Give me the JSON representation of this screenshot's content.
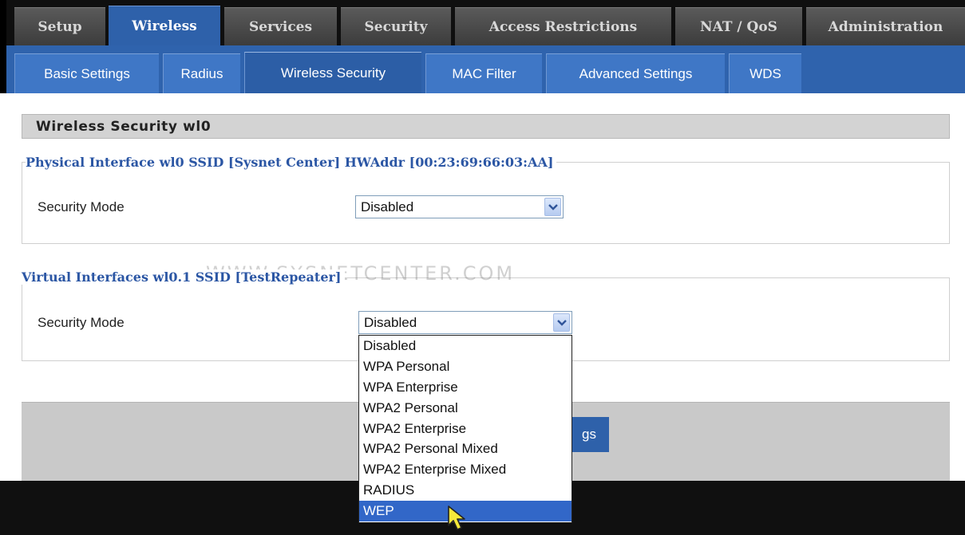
{
  "main_tabs": [
    {
      "label": "Setup"
    },
    {
      "label": "Wireless"
    },
    {
      "label": "Services"
    },
    {
      "label": "Security"
    },
    {
      "label": "Access Restrictions"
    },
    {
      "label": "NAT / QoS"
    },
    {
      "label": "Administration"
    }
  ],
  "active_main_tab": "Wireless",
  "sub_tabs": [
    {
      "label": "Basic Settings"
    },
    {
      "label": "Radius"
    },
    {
      "label": "Wireless Security"
    },
    {
      "label": "MAC Filter"
    },
    {
      "label": "Advanced Settings"
    },
    {
      "label": "WDS"
    }
  ],
  "active_sub_tab": "Wireless Security",
  "section_title": "Wireless Security wl0",
  "physical_interface": {
    "legend": "Physical Interface wl0 SSID [Sysnet Center] HWAddr [00:23:69:66:03:AA]",
    "security_mode_label": "Security Mode",
    "security_mode_value": "Disabled"
  },
  "virtual_interface": {
    "legend": "Virtual Interfaces wl0.1 SSID [TestRepeater]",
    "security_mode_label": "Security Mode",
    "security_mode_value": "Disabled"
  },
  "watermark": "WWW.SYSNETCENTER.COM",
  "dropdown_options": [
    "Disabled",
    "WPA Personal",
    "WPA Enterprise",
    "WPA2 Personal",
    "WPA2 Enterprise",
    "WPA2 Personal Mixed",
    "WPA2 Enterprise Mixed",
    "RADIUS",
    "WEP"
  ],
  "dropdown_highlighted": "WEP",
  "save_button_visible_text": "gs",
  "colors": {
    "accent_blue": "#2e61aa",
    "legend_blue": "#2b56a4",
    "highlight": "#3267c8",
    "cursor_yellow": "#f5e93a"
  }
}
